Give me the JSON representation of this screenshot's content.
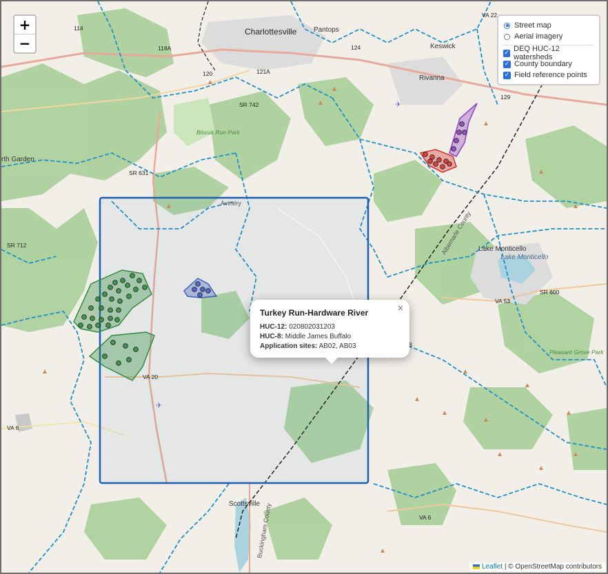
{
  "zoom": {
    "in_label": "+",
    "out_label": "−"
  },
  "layer_control": {
    "base_layers": [
      {
        "label": "Street map",
        "selected": true
      },
      {
        "label": "Aerial imagery",
        "selected": false
      }
    ],
    "overlays": [
      {
        "label": "DEQ HUC-12 watersheds",
        "checked": true
      },
      {
        "label": "County boundary",
        "checked": true
      },
      {
        "label": "Field reference points",
        "checked": true
      }
    ]
  },
  "popup": {
    "title": "Turkey Run-Hardware River",
    "huc12_label": "HUC-12:",
    "huc12_value": "020802031203",
    "huc8_label": "HUC-8:",
    "huc8_value": "Middle James Buffalo",
    "sites_label": "Application sites:",
    "sites_value": "AB02, AB03",
    "close": "×"
  },
  "attribution": {
    "leaflet": "Leaflet",
    "separator": "|",
    "copyright": "© OpenStreetMap contributors"
  },
  "map_labels": {
    "charlottesville": "Charlottesville",
    "pantops": "Pantops",
    "keswick": "Keswick",
    "rivanna": "Rivanna",
    "garden": "rth Garden",
    "biscuit_run": "Biscuit Run Park",
    "lake_monticello_town": "Lake Monticello",
    "lake_monticello": "Lake Monticello",
    "pleasant_grove": "Pleasant Grove Park",
    "scottsville": "Scottsville",
    "albemarle_county": "Albemarle County",
    "buckingham_county": "Buckingham County",
    "avinery": "Avinery"
  },
  "route_shields": {
    "va22": "VA 22",
    "r114": "114",
    "r118a": "118A",
    "r120": "120",
    "r121a": "121A",
    "r124": "124",
    "r129": "129",
    "sr742": "SR 742",
    "sr631": "SR 631",
    "sr712": "SR 712",
    "va53": "VA 53",
    "sr600": "SR 600",
    "va20": "VA 20",
    "va6_west": "VA 6",
    "va6_east": "VA 6",
    "route_b": "B"
  },
  "field_sites": [
    {
      "name": "green-site-cluster",
      "color": "#2e8b3c"
    },
    {
      "name": "blue-site-cluster",
      "color": "#3b5fc0"
    },
    {
      "name": "red-site-cluster",
      "color": "#d22f26"
    },
    {
      "name": "purple-site-cluster",
      "color": "#8c3fc1"
    }
  ],
  "colors": {
    "watershed_line": "#1f8fc8",
    "county_line": "#222222",
    "selected_watershed": "#1a5fb4",
    "forest": "#add19e",
    "road_major": "#e8a89a",
    "water": "#aad3df"
  }
}
